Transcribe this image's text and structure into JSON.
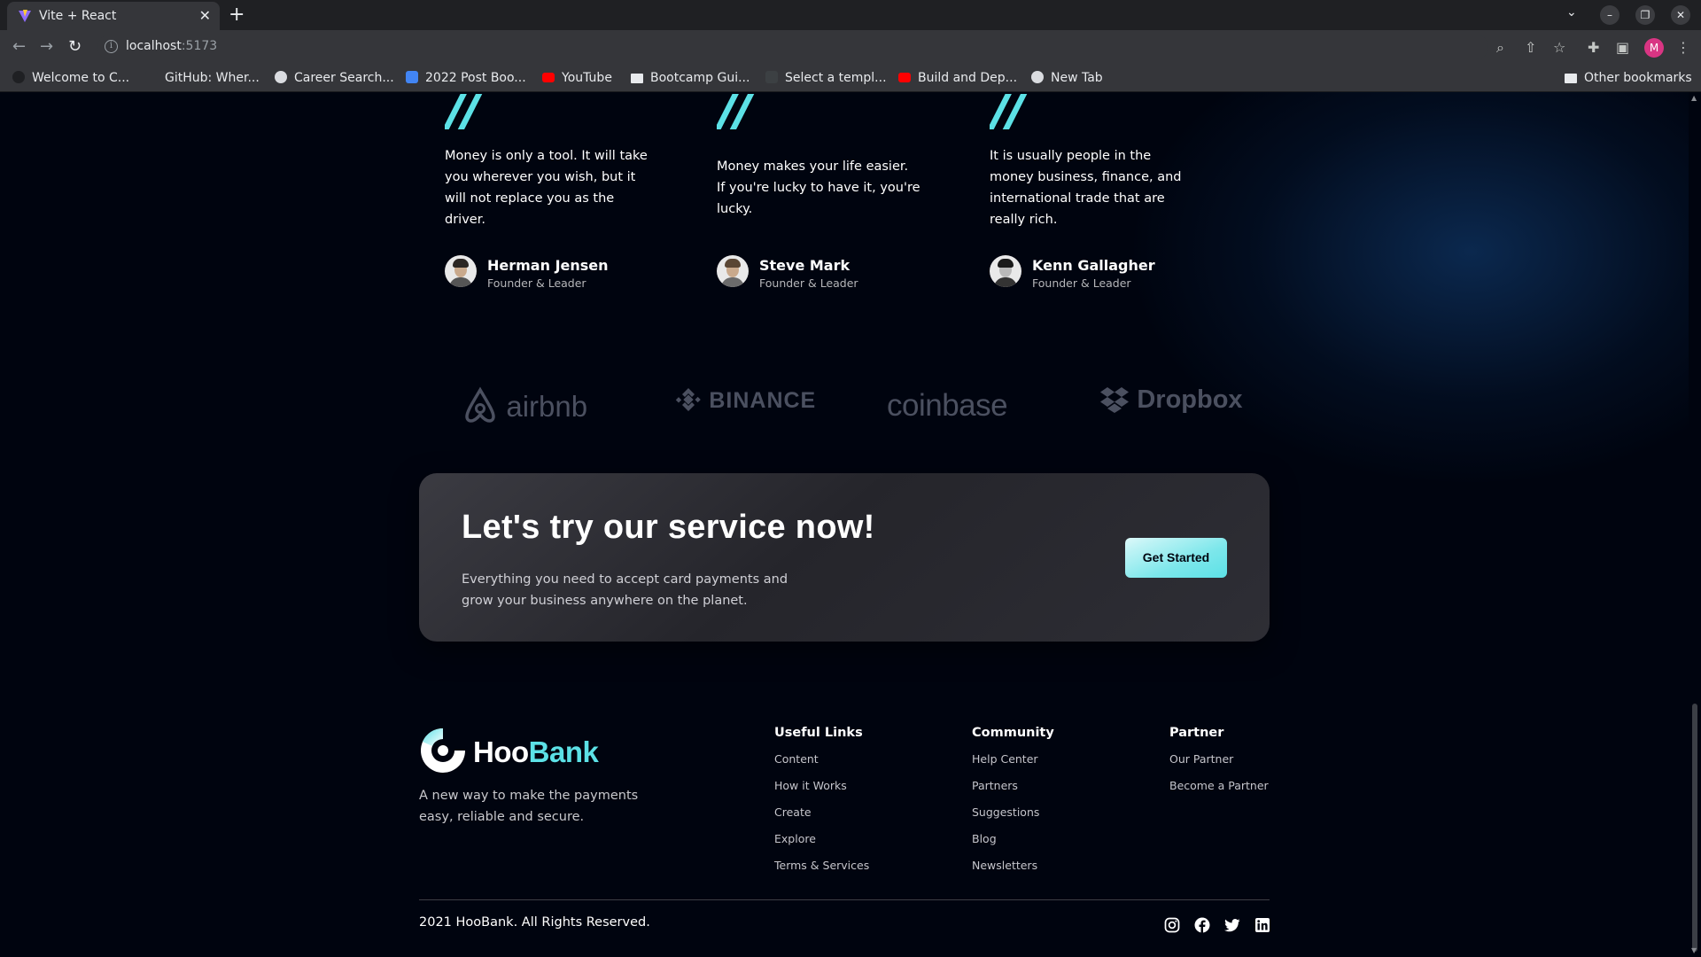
{
  "browser": {
    "tab_title": "Vite + React",
    "url_host": "localhost",
    "url_port": ":5173",
    "avatar_letter": "M",
    "bookmarks": [
      {
        "label": "Welcome to C...",
        "icon": "globe-icon",
        "color": "#1f2023"
      },
      {
        "label": "GitHub: Wher...",
        "icon": "github-icon",
        "color": "#35363a"
      },
      {
        "label": "Career Search...",
        "icon": "globe-icon",
        "color": "#dadce0"
      },
      {
        "label": "2022 Post Boo...",
        "icon": "docs-icon",
        "color": "#4285f4"
      },
      {
        "label": "YouTube",
        "icon": "youtube-icon",
        "color": "#ff0000"
      },
      {
        "label": "Bootcamp Gui...",
        "icon": "folder-icon",
        "color": "#e8eaed"
      },
      {
        "label": "Select a templ...",
        "icon": "page-icon",
        "color": "#3c4043"
      },
      {
        "label": "Build and Dep...",
        "icon": "youtube-icon",
        "color": "#ff0000"
      },
      {
        "label": "New Tab",
        "icon": "globe-icon",
        "color": "#dadce0"
      }
    ],
    "other_bookmarks": "Other bookmarks"
  },
  "testimonials": [
    {
      "quote": "Money is only a tool. It will take you wherever you wish, but it will not replace you as the driver.",
      "name": "Herman Jensen",
      "title": "Founder & Leader"
    },
    {
      "quote": "Money makes your life easier. If you're lucky to have it, you're lucky.",
      "name": "Steve Mark",
      "title": "Founder & Leader"
    },
    {
      "quote": "It is usually people in the money business, finance, and international trade that are really rich.",
      "name": "Kenn Gallagher",
      "title": "Founder & Leader"
    }
  ],
  "clients": [
    "airbnb",
    "BINANCE",
    "coinbase",
    "Dropbox"
  ],
  "cta": {
    "title": "Let's try our service now!",
    "text": "Everything you need to accept card payments and grow your business anywhere on the planet.",
    "button": "Get Started"
  },
  "footer": {
    "brand_main": "Hoo",
    "brand_accent": "Bank",
    "tagline": "A new way to make the payments easy, reliable and secure.",
    "columns": [
      {
        "title": "Useful Links",
        "links": [
          "Content",
          "How it Works",
          "Create",
          "Explore",
          "Terms & Services"
        ]
      },
      {
        "title": "Community",
        "links": [
          "Help Center",
          "Partners",
          "Suggestions",
          "Blog",
          "Newsletters"
        ]
      },
      {
        "title": "Partner",
        "links": [
          "Our Partner",
          "Become a Partner"
        ]
      }
    ],
    "copyright": "2021 HooBank. All Rights Reserved.",
    "social": [
      "instagram-icon",
      "facebook-icon",
      "twitter-icon",
      "linkedin-icon"
    ]
  },
  "colors": {
    "accent": "#5ce1e6",
    "background": "#00040f"
  }
}
